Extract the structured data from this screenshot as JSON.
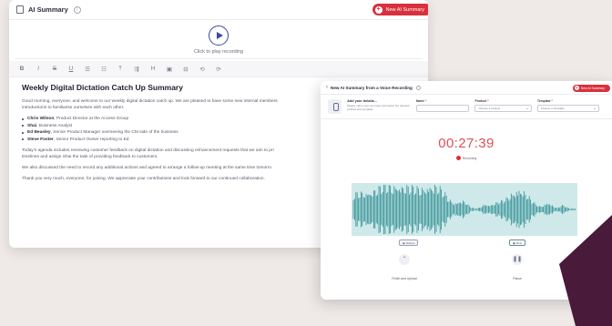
{
  "summary_window": {
    "title": "AI Summary",
    "new_button": "New AI Summary",
    "play_hint": "Click to play recording",
    "toolbar": [
      "B",
      "I",
      "S",
      "U",
      "☰",
      "☷",
      "⤒",
      "⇶",
      "H",
      "▣",
      "⊟",
      "⟲",
      "⟳"
    ],
    "doc_title": "Weekly Digital Dictation Catch Up Summary",
    "intro": "Good morning, everyone, and welcome to our weekly digital dictation catch up. We are pleased to have some new internal members",
    "intro2": "introductions to familiarise ourselves with each other.",
    "attendees": [
      {
        "name": "Chris Wilson",
        "role": ", Product Director at the Access Group"
      },
      {
        "name": "Shai",
        "role": ", Business Analyst"
      },
      {
        "name": "Ed Beasley",
        "role": ", Senior Product Manager overseeing the CM side of the business"
      },
      {
        "name": "Steve Foster",
        "role": ", Senior Product Owner reporting to Ed"
      }
    ],
    "agenda": "Today's agenda includes reviewing customer feedback on digital dictation and discussing enhancement requests that we aim to pri",
    "agenda2": "timelines and assign Shai the task of providing feedback to customers.",
    "followup": "We also discussed the need to record any additional actions and agreed to arrange a follow-up meeting at the same time tomorro",
    "closing": "Thank you very much, everyone, for joining. We appreciate your contributions and look forward to our continued collaboration."
  },
  "recording_window": {
    "title": "New AI Summary from a Voice Recording",
    "new_button": "New AI Summary",
    "audio_title": "Add your details...",
    "audio_desc": "Please name your summary and select the relevant product and template",
    "name_label": "Name",
    "product_label": "Product",
    "product_value": "Choose a product",
    "template_label": "Template",
    "template_value": "Choose a Template",
    "timer": "00:27:39",
    "recording_label": "Recording",
    "volume_label": "Volume",
    "mute_label": "Mute",
    "finish_label": "Finish and Upload",
    "pause_label": "Pause"
  },
  "colors": {
    "accent_red": "#d9303d",
    "timer_red": "#e24d57",
    "wave_teal": "#2f8e93",
    "wave_bg": "#cfe9ea",
    "brand_purple": "#3b4aa0",
    "deco_maroon": "#4a1a3a"
  }
}
